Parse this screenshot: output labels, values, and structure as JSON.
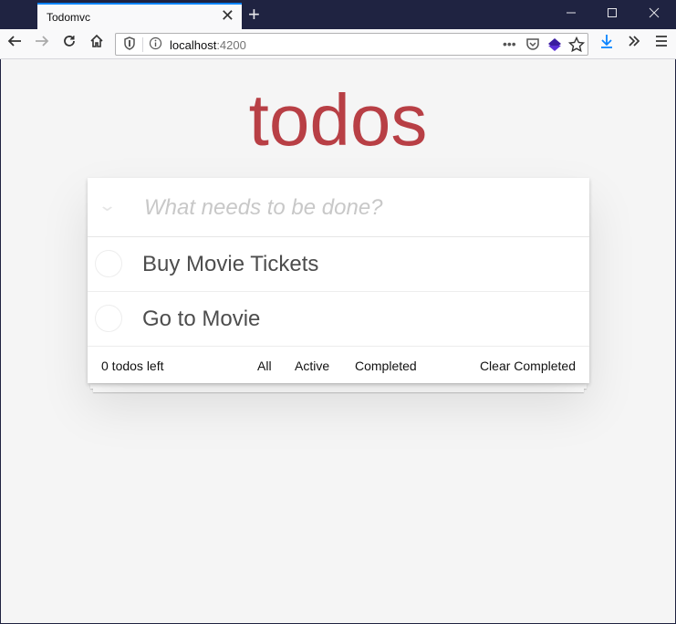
{
  "browser": {
    "tab_title": "Todomvc",
    "url_host": "localhost",
    "url_port": ":4200",
    "icons": {
      "back": "arrow-left",
      "forward": "arrow-right",
      "reload": "reload",
      "home": "home",
      "tracking": "shield",
      "info": "info-circle",
      "more": "ellipsis",
      "pocket": "pocket",
      "extension": "layers",
      "bookmark": "star",
      "downloads": "download-arrow",
      "overflow": "double-chevron",
      "menu": "hamburger"
    },
    "accent_color": "#0a84ff"
  },
  "app": {
    "title": "todos",
    "title_color": "#b83f45",
    "new_todo_placeholder": "What needs to be done?",
    "new_todo_value": "",
    "todos": [
      {
        "label": "Buy Movie Tickets",
        "completed": false
      },
      {
        "label": "Go to Movie",
        "completed": false
      }
    ],
    "footer": {
      "count_text": "0 todos left",
      "filters": [
        "All",
        "Active",
        "Completed"
      ],
      "clear_label": "Clear Completed"
    }
  }
}
